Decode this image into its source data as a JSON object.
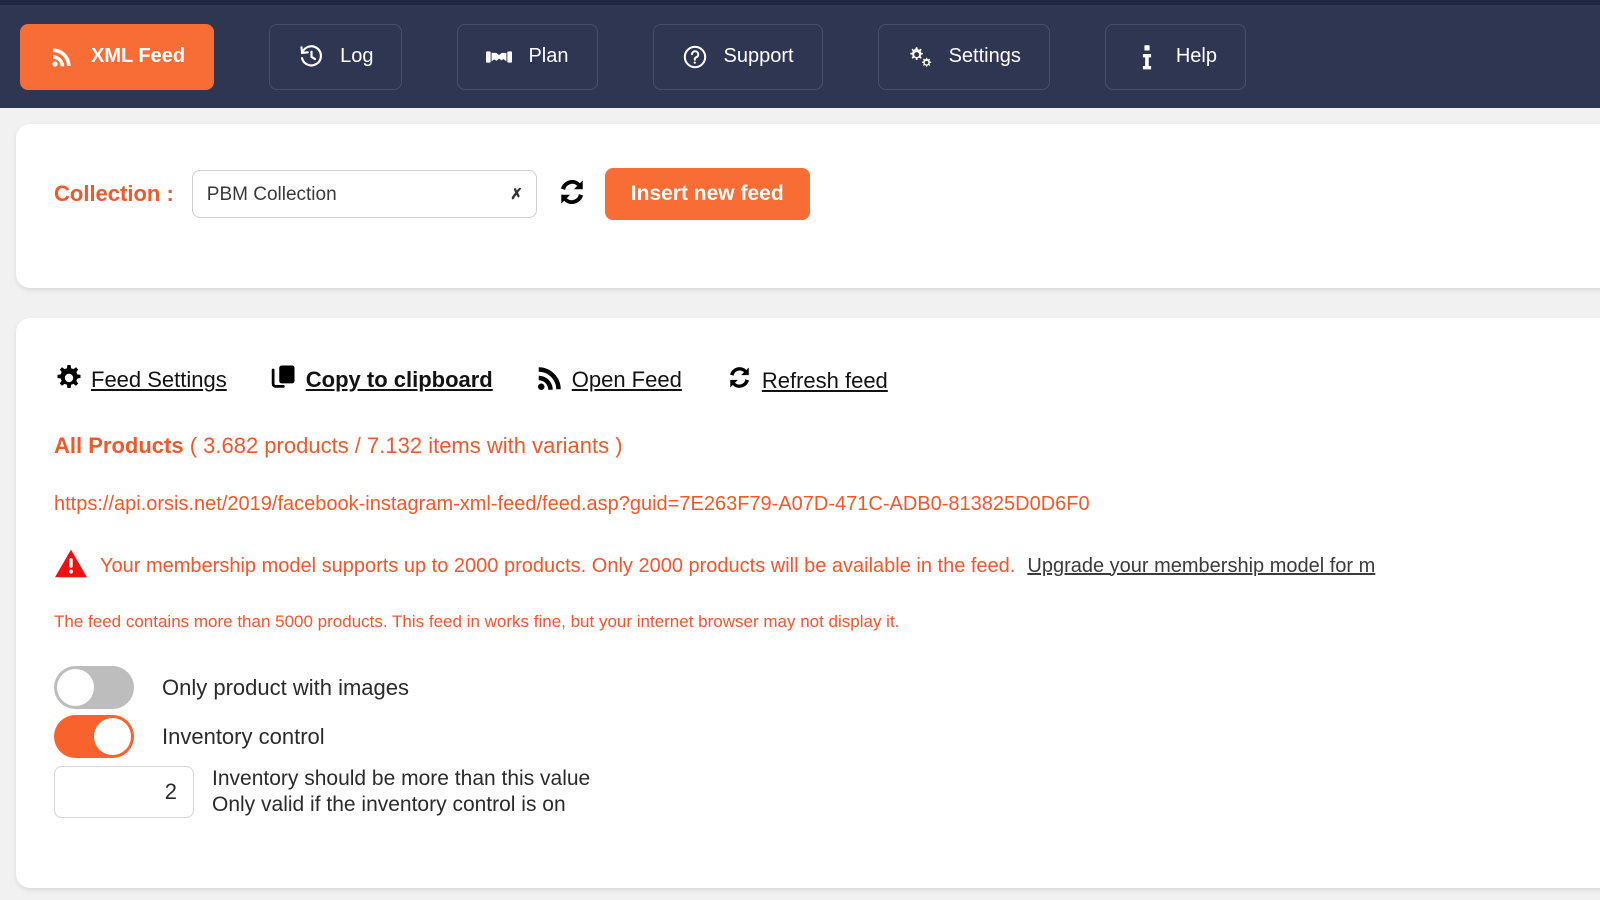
{
  "nav": {
    "items": [
      {
        "label": "XML Feed",
        "icon": "rss-icon",
        "active": true
      },
      {
        "label": "Log",
        "icon": "history-icon",
        "active": false
      },
      {
        "label": "Plan",
        "icon": "handshake-icon",
        "active": false
      },
      {
        "label": "Support",
        "icon": "question-circle-icon",
        "active": false
      },
      {
        "label": "Settings",
        "icon": "gears-icon",
        "active": false
      },
      {
        "label": "Help",
        "icon": "info-icon",
        "active": false
      }
    ]
  },
  "collection": {
    "label": "Collection :",
    "selected": "PBM Collection",
    "options": [
      "PBM Collection"
    ],
    "refresh_icon": "refresh-icon",
    "insert_button": "Insert new feed"
  },
  "feed": {
    "toolbar": [
      {
        "label": "Feed Settings",
        "icon": "gear-icon",
        "bold": false
      },
      {
        "label": "Copy to clipboard",
        "icon": "clipboard-copy-icon",
        "bold": true
      },
      {
        "label": "Open Feed",
        "icon": "rss-icon",
        "bold": false
      },
      {
        "label": "Refresh feed",
        "icon": "refresh-icon",
        "bold": false
      }
    ],
    "products_title": "All Products",
    "products_count": "( 3.682 products / 7.132 items with variants )",
    "url": "https://api.orsis.net/2019/facebook-instagram-xml-feed/feed.asp?guid=7E263F79-A07D-471C-ADB0-813825D0D6F0",
    "warning_icon": "warning-triangle-icon",
    "warning_text": "Your membership model supports up to 2000 products. Only 2000 products will be available in the feed.",
    "warning_link": "Upgrade your membership model for m",
    "sub_warning": "The feed contains more than 5000 products. This feed in works fine, but your internet browser may not display it.",
    "toggles": [
      {
        "label": "Only product with images",
        "state": "off"
      },
      {
        "label": "Inventory control",
        "state": "on"
      }
    ],
    "inventory_value": "2",
    "inventory_desc_line1": "Inventory should be more than this value",
    "inventory_desc_line2": "Only valid if the inventory control is on"
  },
  "colors": {
    "accent_orange": "#f86c35",
    "nav_background": "#2f3652",
    "warning_red": "#ee1111",
    "page_background": "#f1f1f1"
  }
}
